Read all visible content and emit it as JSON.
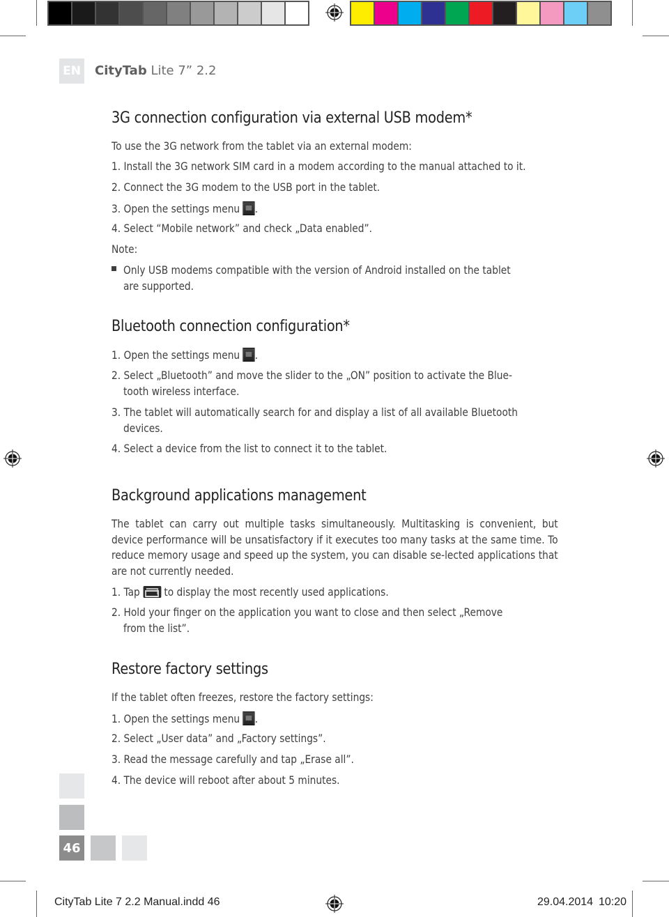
{
  "print_marks": {
    "grayscale_swatches": [
      "#000000",
      "#1a1a1a",
      "#333333",
      "#4d4d4d",
      "#666666",
      "#808080",
      "#999999",
      "#b3b3b3",
      "#cccccc",
      "#e6e6e6",
      "#ffffff"
    ],
    "color_swatches": [
      "#ffed00",
      "#ec008c",
      "#00aeef",
      "#2e3192",
      "#00a651",
      "#ed1c24",
      "#231f20",
      "#fff799",
      "#f49ac1",
      "#6dcff6",
      "#8f8f8f"
    ]
  },
  "header": {
    "lang": "EN",
    "brand": "CityTab",
    "model": "Lite 7” 2.2"
  },
  "sections": {
    "usb_modem": {
      "title": "3G connection configuration via external USB modem*",
      "intro": "To use the 3G network from the tablet via an external modem:",
      "steps": [
        "1. Install the 3G network SIM card in a modem according to the manual attached to it.",
        "2. Connect the 3G modem to the USB port in the tablet.",
        "3. Open the settings menu",
        "4. Select “Mobile network” and check „Data enabled”."
      ],
      "note_label": "Note:",
      "note_lines": [
        "Only USB modems compatible with the version of Android installed on the tablet",
        "are supported."
      ]
    },
    "bluetooth": {
      "title": "Bluetooth connection configuration*",
      "steps": [
        "1. Open the settings menu",
        "2. Select „Bluetooth” and move the slider to the „ON” position to activate the Blue-",
        "tooth wireless interface.",
        "3. The tablet will automatically search for and display a list of all available Bluetooth",
        "devices.",
        "4. Select a device from the list to connect it to the tablet."
      ]
    },
    "background_apps": {
      "title": "Background applications management",
      "paragraph": "The tablet can carry out multiple tasks simultaneously. Multitasking is convenient, but device performance will be unsatisfactory if it executes too many tasks at the same time. To reduce memory usage and speed up the system, you can disable se-lected applications that are not currently needed.",
      "step1_pre": "1. Tap",
      "step1_post": "to display the most recently used applications.",
      "step2": "2. Hold your finger on the application you want to close and then select „Remove",
      "step2_cont": "from the list”."
    },
    "factory": {
      "title": "Restore factory settings",
      "intro": "If the tablet often freezes, restore the factory settings:",
      "steps": [
        "1. Open the settings menu",
        "2. Select „User data” and „Factory settings”.",
        "3. Read the message carefully and tap „Erase all”.",
        "4. The device will reboot after about 5 minutes."
      ]
    }
  },
  "page_number": "46",
  "footer": {
    "file": "CityTab Lite 7 2.2 Manual.indd   46",
    "date": "29.04.2014",
    "time": "10:20"
  }
}
